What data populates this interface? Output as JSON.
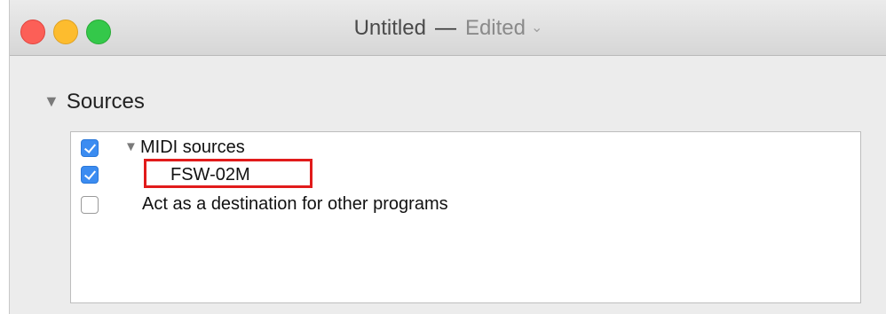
{
  "window": {
    "title": "Untitled",
    "separator": "—",
    "status": "Edited",
    "status_chevron": "⌄"
  },
  "sources": {
    "header": "Sources",
    "disclosure": "▼",
    "items": [
      {
        "label": "MIDI sources",
        "checked": true,
        "disclosure": "▼"
      },
      {
        "label": "FSW-02M",
        "checked": true
      },
      {
        "label": "Act as a destination for other programs",
        "checked": false
      }
    ]
  }
}
